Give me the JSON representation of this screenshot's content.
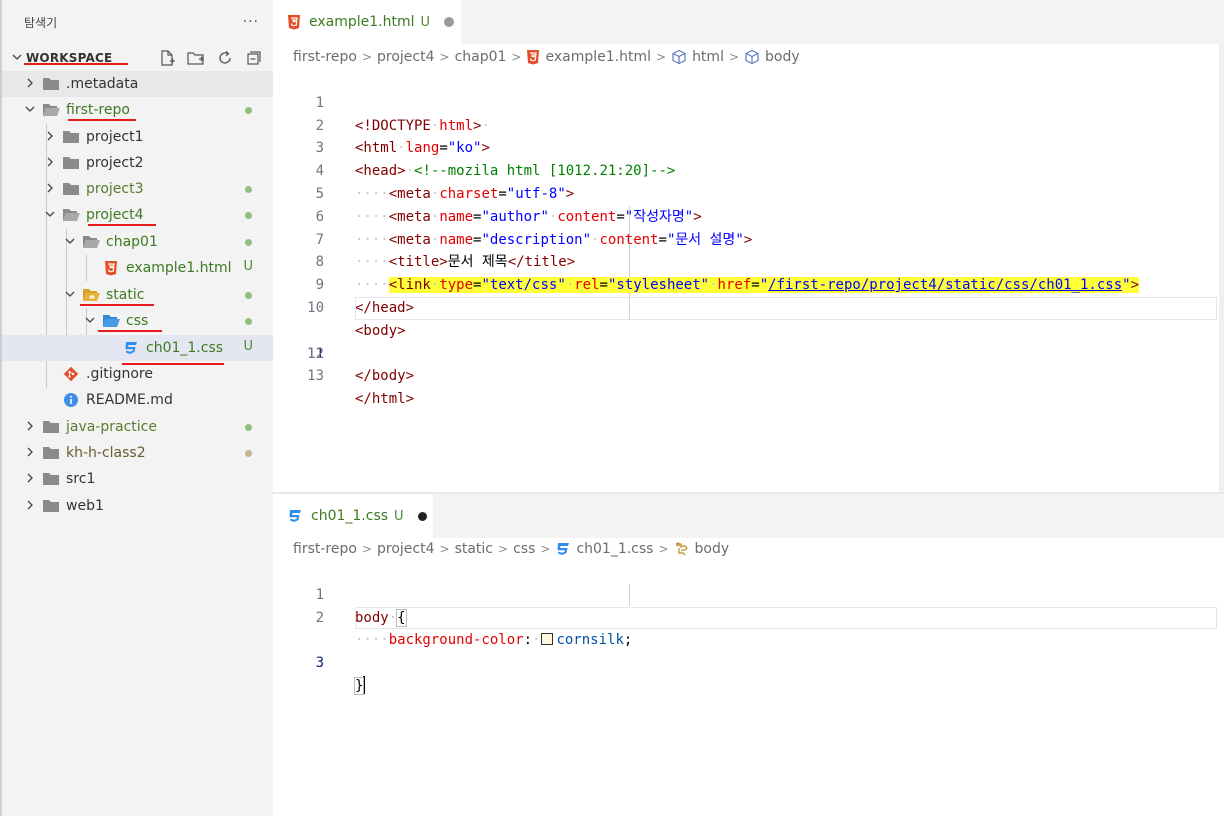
{
  "explorer": {
    "title": "탐색기",
    "more": "···",
    "workspace_label": "WORKSPACE",
    "tree": {
      "metadata": ".metadata",
      "first_repo": "first-repo",
      "project1": "project1",
      "project2": "project2",
      "project3": "project3",
      "project4": "project4",
      "chap01": "chap01",
      "example1": "example1.html",
      "static": "static",
      "css": "css",
      "ch01_css": "ch01_1.css",
      "gitignore": ".gitignore",
      "readme": "README.md",
      "java_practice": "java-practice",
      "kh_h_class2": "kh-h-class2",
      "src1": "src1",
      "web1": "web1",
      "untracked_badge": "U"
    }
  },
  "editor_top": {
    "tab_label": "example1.html",
    "tab_badge": "U",
    "breadcrumb": [
      "first-repo",
      "project4",
      "chap01",
      "example1.html",
      "html",
      "body"
    ],
    "line_numbers": [
      "1",
      "2",
      "3",
      "4",
      "5",
      "6",
      "7",
      "8",
      "9",
      "10",
      "11",
      "12",
      "13"
    ],
    "code": {
      "l1_doctype": "<!DOCTYPE",
      "l1_html": "html",
      "l1_close": ">",
      "l2_open": "<html",
      "l2_attr": "lang",
      "l2_eq": "=",
      "l2_val": "\"ko\"",
      "l2_close": ">",
      "l3_head": "<head>",
      "l3_comment": "<!--mozila html [1012.21:20]-->",
      "l4_tag": "<meta",
      "l4_attr": "charset",
      "l4_val": "\"utf-8\"",
      "l4_close": ">",
      "l5_tag": "<meta",
      "l5_attr1": "name",
      "l5_val1": "\"author\"",
      "l5_attr2": "content",
      "l5_val2": "\"작성자명\"",
      "l5_close": ">",
      "l6_tag": "<meta",
      "l6_attr1": "name",
      "l6_val1": "\"description\"",
      "l6_attr2": "content",
      "l6_val2": "\"문서 설명\"",
      "l6_close": ">",
      "l7_open": "<title>",
      "l7_text": "문서 제목",
      "l7_close": "</title>",
      "l8_tag": "<link",
      "l8_attr1": "type",
      "l8_val1": "\"text/css\"",
      "l8_attr2": "rel",
      "l8_val2": "\"stylesheet\"",
      "l8_attr3": "href",
      "l8_q": "\"",
      "l8_path": "/first-repo/project4/static/css/ch01_1.css",
      "l8_close": ">",
      "l9": "</head>",
      "l10": "<body>",
      "l12": "</body>",
      "l13": "</html>"
    }
  },
  "editor_bottom": {
    "tab_label": "ch01_1.css",
    "tab_badge": "U",
    "breadcrumb": [
      "first-repo",
      "project4",
      "static",
      "css",
      "ch01_1.css",
      "body"
    ],
    "line_numbers": [
      "1",
      "2",
      "3"
    ],
    "code": {
      "l1_selector": "body",
      "l1_brace": "{",
      "l2_prop": "background-color",
      "l2_colon": ":",
      "l2_value": "cornsilk",
      "l2_semi": ";",
      "l3_brace": "}"
    },
    "swatch_color": "#fff8dc"
  },
  "colors": {
    "html_icon": "#e44d26",
    "css_icon": "#2f8ff0",
    "folder": "#8a8a8a",
    "folder_special": "#e5b23a",
    "folder_css": "#4a9be8",
    "git_icon": "#e24e2b",
    "info_icon": "#3f8fe8",
    "annotation_red": "#e81c1c"
  }
}
